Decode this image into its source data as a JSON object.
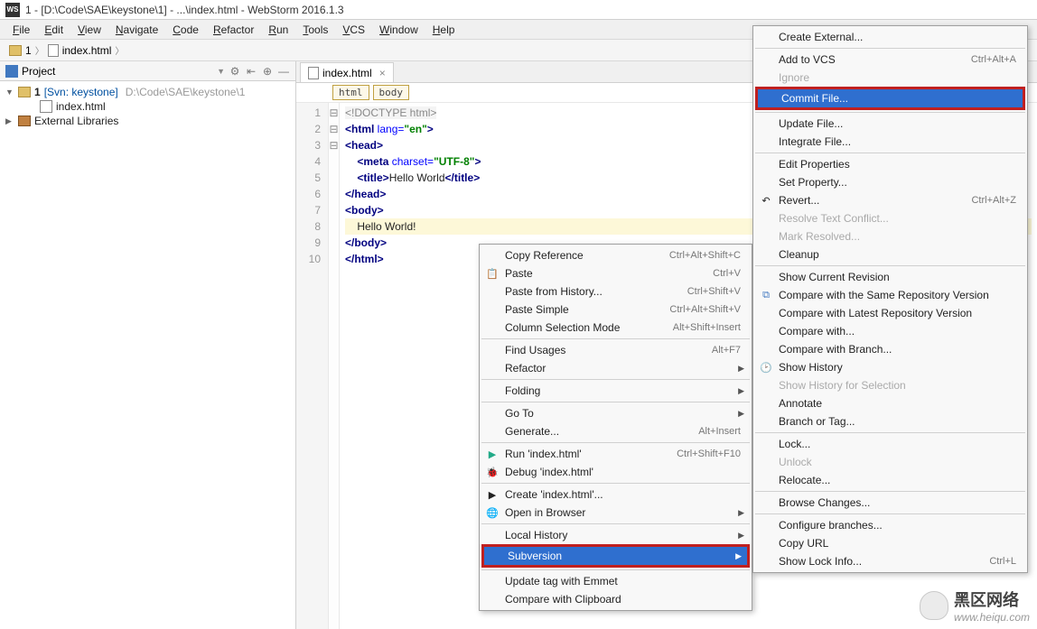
{
  "title": "1 - [D:\\Code\\SAE\\keystone\\1] - ...\\index.html - WebStorm 2016.1.3",
  "menubar": [
    "File",
    "Edit",
    "View",
    "Navigate",
    "Code",
    "Refactor",
    "Run",
    "Tools",
    "VCS",
    "Window",
    "Help"
  ],
  "navbar": {
    "root": "1",
    "file": "index.html"
  },
  "sidebar": {
    "title": "Project",
    "root": {
      "label": "1",
      "svn": "[Svn: keystone]",
      "path": "D:\\Code\\SAE\\keystone\\1"
    },
    "file": "index.html",
    "external": "External Libraries"
  },
  "editor": {
    "tab": "index.html",
    "breadcrumbs": [
      "html",
      "body"
    ],
    "lines": [
      "1",
      "2",
      "3",
      "4",
      "5",
      "6",
      "7",
      "8",
      "9",
      "10"
    ],
    "code": {
      "l1": "<!DOCTYPE html>",
      "l2_open": "<",
      "l2_tag": "html",
      "l2_attr": " lang=",
      "l2_val": "\"en\"",
      "l2_close": ">",
      "l3": "<head>",
      "l4_a": "    <",
      "l4_tag": "meta",
      "l4_attr": " charset=",
      "l4_val": "\"UTF-8\"",
      "l4_c": ">",
      "l5_a": "    <",
      "l5_tag": "title",
      "l5_b": ">",
      "l5_txt": "Hello World",
      "l5_c": "</",
      "l5_d": ">",
      "l6": "</head>",
      "l7": "<body>",
      "l8": "    Hello World!",
      "l9": "</body>",
      "l10": "</html>"
    }
  },
  "ctx1": [
    {
      "label": "Copy Reference",
      "shortcut": "Ctrl+Alt+Shift+C"
    },
    {
      "label": "Paste",
      "shortcut": "Ctrl+V",
      "icon": "paste"
    },
    {
      "label": "Paste from History...",
      "shortcut": "Ctrl+Shift+V"
    },
    {
      "label": "Paste Simple",
      "shortcut": "Ctrl+Alt+Shift+V"
    },
    {
      "label": "Column Selection Mode",
      "shortcut": "Alt+Shift+Insert"
    },
    {
      "sep": true
    },
    {
      "label": "Find Usages",
      "shortcut": "Alt+F7"
    },
    {
      "label": "Refactor",
      "sub": true
    },
    {
      "sep": true
    },
    {
      "label": "Folding",
      "sub": true
    },
    {
      "sep": true
    },
    {
      "label": "Go To",
      "sub": true
    },
    {
      "label": "Generate...",
      "shortcut": "Alt+Insert"
    },
    {
      "sep": true
    },
    {
      "label": "Run 'index.html'",
      "shortcut": "Ctrl+Shift+F10",
      "icon": "run"
    },
    {
      "label": "Debug 'index.html'",
      "icon": "bug"
    },
    {
      "sep": true
    },
    {
      "label": "Create 'index.html'...",
      "icon": "create"
    },
    {
      "label": "Open in Browser",
      "sub": true,
      "icon": "browser"
    },
    {
      "sep": true
    },
    {
      "label": "Local History",
      "sub": true
    },
    {
      "label": "Subversion",
      "sub": true,
      "sel": true,
      "redbox": true
    },
    {
      "sep": true
    },
    {
      "label": "Update tag with Emmet"
    },
    {
      "label": "Compare with Clipboard"
    }
  ],
  "ctx2": [
    {
      "label": "Create External..."
    },
    {
      "sep": true
    },
    {
      "label": "Add to VCS",
      "shortcut": "Ctrl+Alt+A"
    },
    {
      "label": "Ignore",
      "disabled": true
    },
    {
      "label": "Commit File...",
      "sel": true,
      "redbox": true
    },
    {
      "sep": true
    },
    {
      "label": "Update File..."
    },
    {
      "label": "Integrate File..."
    },
    {
      "sep": true
    },
    {
      "label": "Edit Properties"
    },
    {
      "label": "Set Property..."
    },
    {
      "label": "Revert...",
      "shortcut": "Ctrl+Alt+Z",
      "icon": "revert"
    },
    {
      "label": "Resolve Text Conflict...",
      "disabled": true
    },
    {
      "label": "Mark Resolved...",
      "disabled": true
    },
    {
      "label": "Cleanup"
    },
    {
      "sep": true
    },
    {
      "label": "Show Current Revision"
    },
    {
      "label": "Compare with the Same Repository Version",
      "icon": "compare"
    },
    {
      "label": "Compare with Latest Repository Version"
    },
    {
      "label": "Compare with..."
    },
    {
      "label": "Compare with Branch..."
    },
    {
      "label": "Show History",
      "icon": "history"
    },
    {
      "label": "Show History for Selection",
      "disabled": true
    },
    {
      "label": "Annotate"
    },
    {
      "label": "Branch or Tag..."
    },
    {
      "sep": true
    },
    {
      "label": "Lock..."
    },
    {
      "label": "Unlock",
      "disabled": true
    },
    {
      "label": "Relocate..."
    },
    {
      "sep": true
    },
    {
      "label": "Browse Changes..."
    },
    {
      "sep": true
    },
    {
      "label": "Configure branches..."
    },
    {
      "label": "Copy URL"
    },
    {
      "label": "Show Lock Info...",
      "shortcut": "Ctrl+L"
    }
  ],
  "watermark": {
    "cn": "黑区网络",
    "url": "www.heiqu.com"
  }
}
